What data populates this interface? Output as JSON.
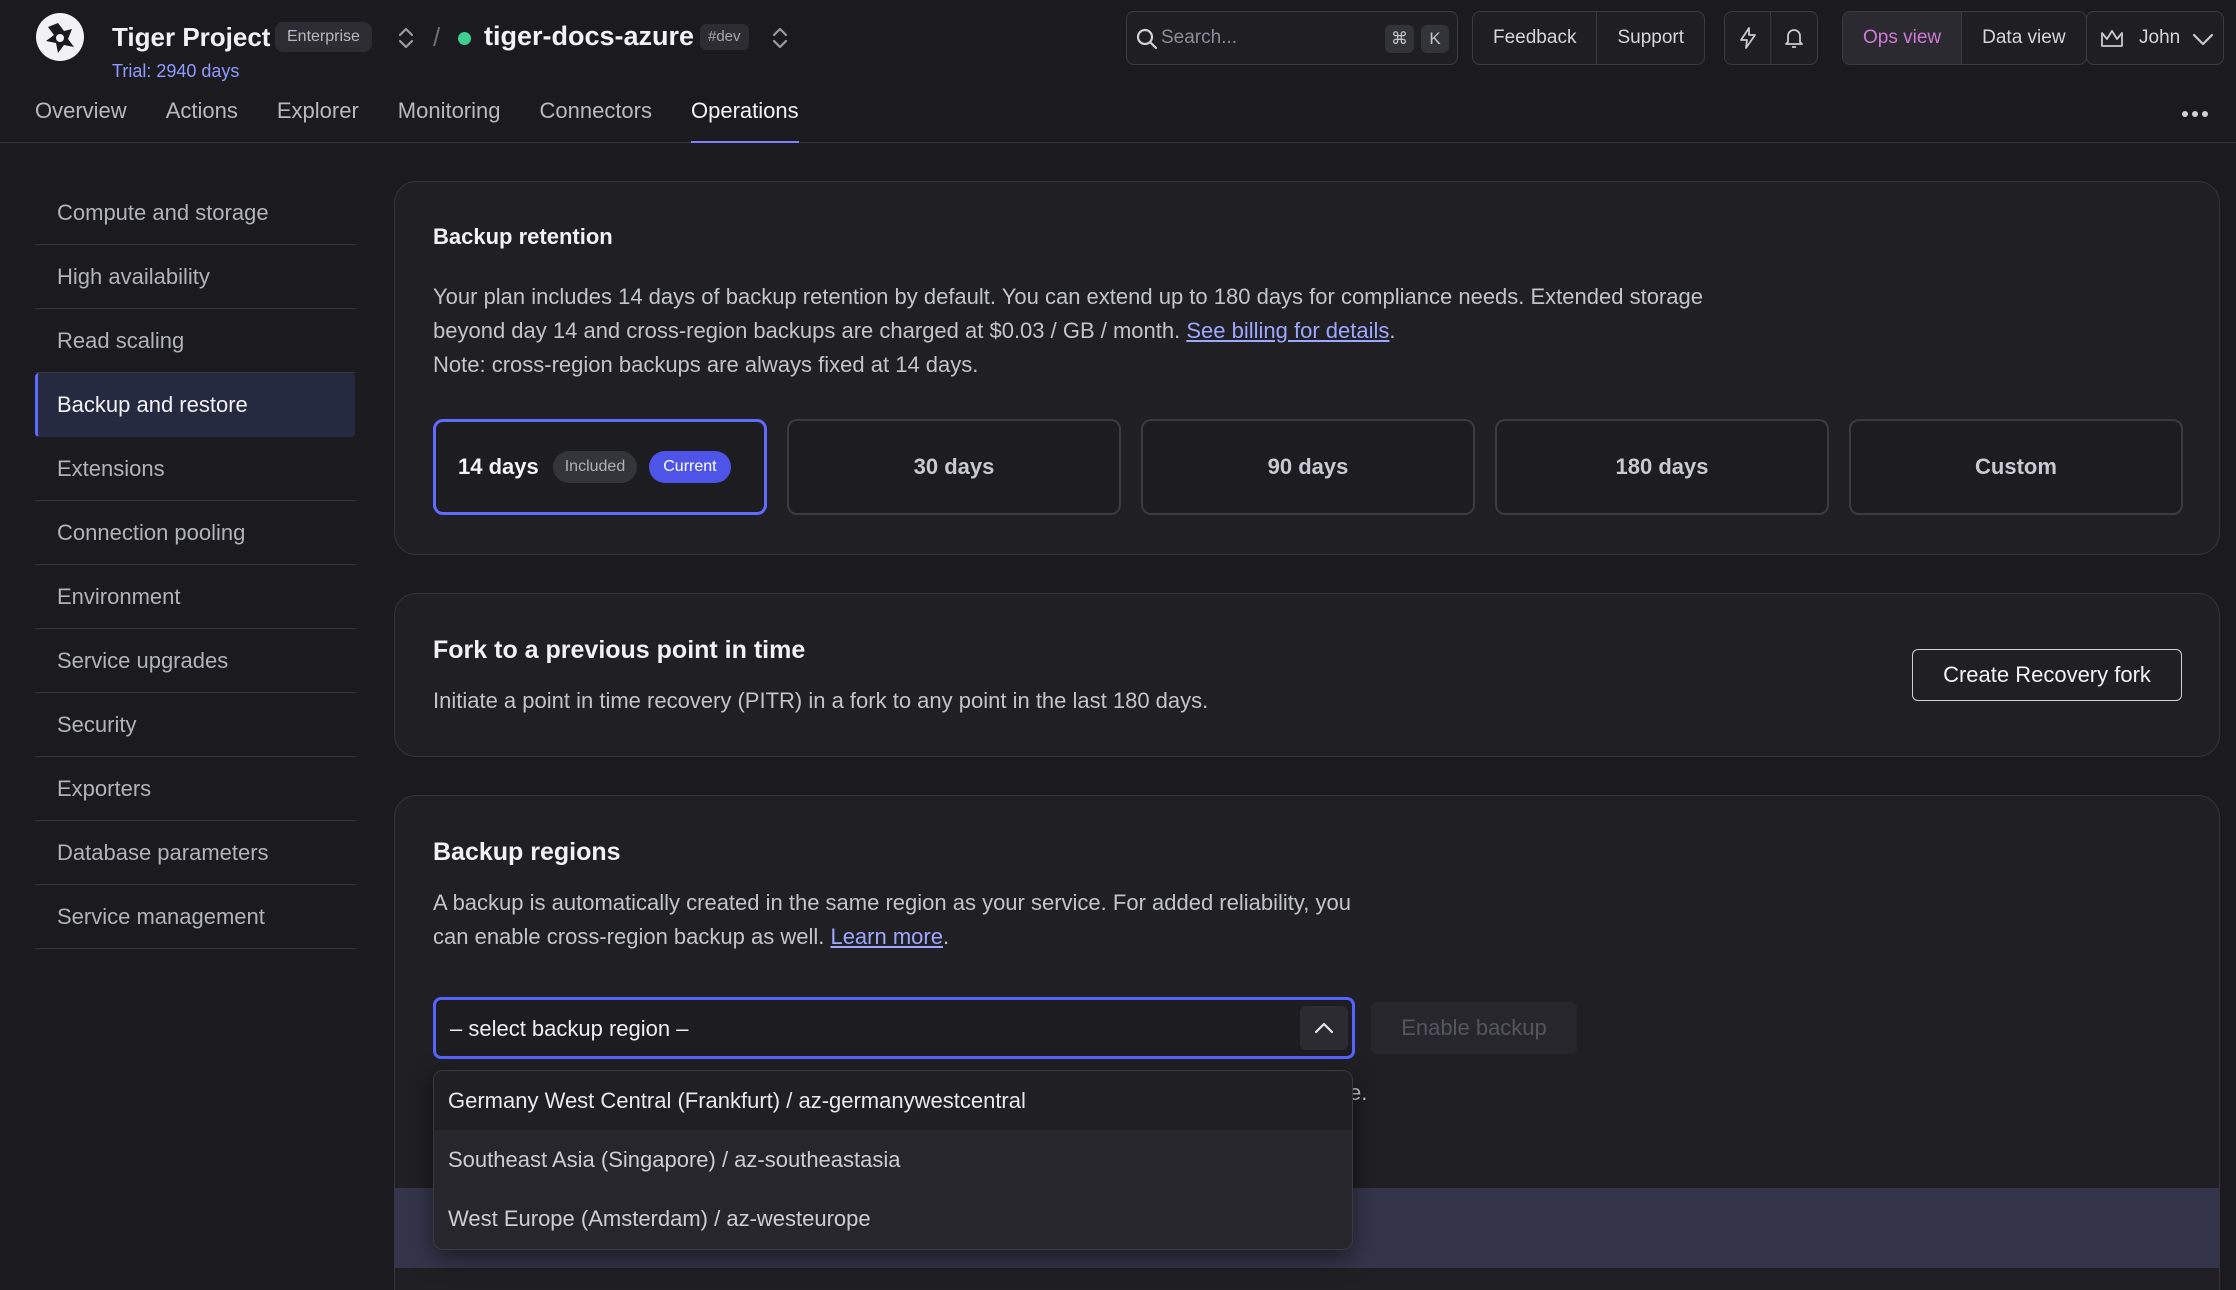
{
  "header": {
    "project_name": "Tiger Project",
    "plan_badge": "Enterprise",
    "trial_text": "Trial: 2940 days",
    "separator": "/",
    "service_name": "tiger-docs-azure",
    "service_status_color": "#3ecf8e",
    "env_badge": "#dev",
    "search_placeholder": "Search...",
    "search_shortcut_keys": [
      "⌘",
      "K"
    ],
    "feedback_label": "Feedback",
    "support_label": "Support",
    "ops_view_label": "Ops view",
    "data_view_label": "Data view",
    "user_name": "John"
  },
  "nav": {
    "tabs": [
      "Overview",
      "Actions",
      "Explorer",
      "Monitoring",
      "Connectors",
      "Operations"
    ],
    "active_tab": "Operations"
  },
  "sidebar": {
    "items": [
      "Compute and storage",
      "High availability",
      "Read scaling",
      "Backup and restore",
      "Extensions",
      "Connection pooling",
      "Environment",
      "Service upgrades",
      "Security",
      "Exporters",
      "Database parameters",
      "Service management"
    ],
    "active_item": "Backup and restore"
  },
  "backup_retention": {
    "title": "Backup retention",
    "desc_line1": "Your plan includes 14 days of backup retention by default. You can extend up to 180 days for compliance needs. Extended storage",
    "desc_line2_prefix": "beyond day 14 and cross-region backups are charged at $0.03 / GB / month. ",
    "desc_link": "See billing for details",
    "desc_line2_suffix": ".",
    "desc_line3": "Note: cross-region backups are always fixed at 14 days.",
    "options": [
      "14 days",
      "30 days",
      "90 days",
      "180 days",
      "Custom"
    ],
    "selected_option": "14 days",
    "included_tag": "Included",
    "current_tag": "Current"
  },
  "fork": {
    "title": "Fork to a previous point in time",
    "description": "Initiate a point in time recovery (PITR) in a fork to any point in the last 180 days.",
    "button_label": "Create Recovery fork"
  },
  "backup_regions": {
    "title": "Backup regions",
    "desc_line1": "A backup is automatically created in the same region as your service. For added reliability, you",
    "desc_line2_prefix": "can enable cross-region backup as well. ",
    "desc_link": "Learn more",
    "desc_line2_suffix": ".",
    "select_value": "– select backup region –",
    "enable_button": "Enable backup",
    "hidden_fragment": "e.",
    "dropdown_options": [
      "Germany West Central (Frankfurt) / az-germanywestcentral",
      "Southeast Asia (Singapore) / az-southeastasia",
      "West Europe (Amsterdam) / az-westeurope"
    ]
  },
  "colors": {
    "accent": "#5d6bff",
    "link": "#9ea7ff",
    "ops_view_active": "#d07ad7",
    "background": "#1b1b1f",
    "card": "#1f1f24"
  }
}
